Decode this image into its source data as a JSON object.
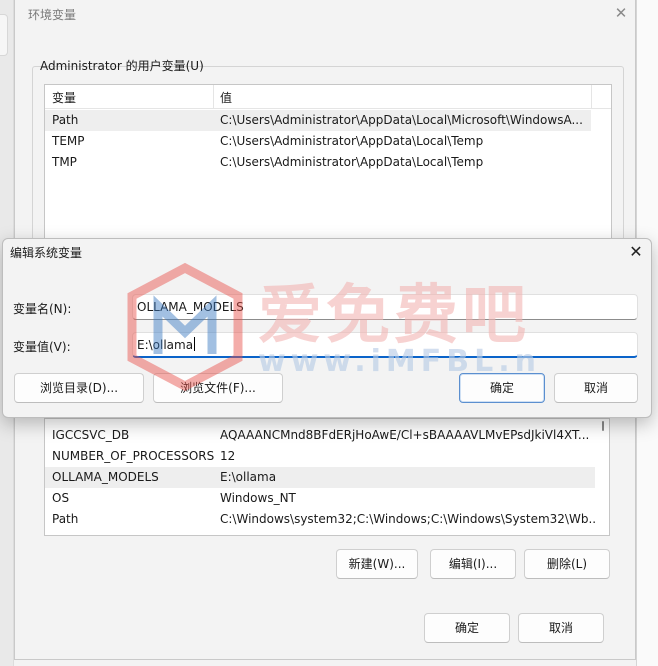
{
  "env_window": {
    "title": "环境变量",
    "close_glyph": "✕",
    "user_group_label": "Administrator 的用户变量(U)",
    "columns": [
      "变量",
      "值"
    ],
    "user_vars": [
      {
        "name": "Path",
        "value": "C:\\Users\\Administrator\\AppData\\Local\\Microsoft\\WindowsA..."
      },
      {
        "name": "TEMP",
        "value": "C:\\Users\\Administrator\\AppData\\Local\\Temp"
      },
      {
        "name": "TMP",
        "value": "C:\\Users\\Administrator\\AppData\\Local\\Temp"
      }
    ],
    "system_vars": [
      {
        "name": "IGCCSVC_DB",
        "value": "AQAAANCMnd8BFdERjHoAwE/Cl+sBAAAAVLMvEPsdJkiVl4XT..."
      },
      {
        "name": "NUMBER_OF_PROCESSORS",
        "value": "12"
      },
      {
        "name": "OLLAMA_MODELS",
        "value": "E:\\ollama"
      },
      {
        "name": "OS",
        "value": "Windows_NT"
      },
      {
        "name": "Path",
        "value": "C:\\Windows\\system32;C:\\Windows;C:\\Windows\\System32\\Wb..."
      }
    ],
    "system_buttons": {
      "new": "新建(W)...",
      "edit": "编辑(I)...",
      "delete": "删除(L)"
    },
    "ok": "确定",
    "cancel": "取消"
  },
  "edit_dialog": {
    "title": "编辑系统变量",
    "close_glyph": "✕",
    "name_label": "变量名(N):",
    "name_value": "OLLAMA_MODELS",
    "value_label": "变量值(V):",
    "value_value": "E:\\ollama",
    "browse_dir": "浏览目录(D)...",
    "browse_file": "浏览文件(F)...",
    "ok": "确定",
    "cancel": "取消"
  },
  "watermark": {
    "text": "爱免费吧",
    "sub": "www.iMFBL.n"
  },
  "colors": {
    "accent": "#0a63c9",
    "watermark_red": "#e8504a",
    "watermark_blue": "#3a78c2"
  }
}
